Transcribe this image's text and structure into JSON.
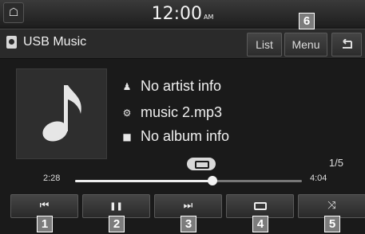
{
  "status_bar": {
    "home_icon": "home-icon",
    "time": "12:00",
    "ampm": "AM"
  },
  "header": {
    "source_icon": "usb-music-icon",
    "title": "USB Music",
    "list_label": "List",
    "menu_label": "Menu",
    "back_icon": "back-arrow-icon"
  },
  "album_art_icon": "music-note-icon",
  "track_info": {
    "artist": "No artist info",
    "file": "music 2.mp3",
    "album": "No album info"
  },
  "playback": {
    "repeat_icon": "repeat-indicator-icon",
    "track_count": "1/5",
    "elapsed": "2:28",
    "total": "4:04",
    "progress": 0.605
  },
  "controls": [
    {
      "icon": "previous-track-icon",
      "glyph": "⏮"
    },
    {
      "icon": "pause-icon",
      "glyph": "❚❚"
    },
    {
      "icon": "next-track-icon",
      "glyph": "⏭"
    },
    {
      "icon": "repeat-icon",
      "glyph": ""
    },
    {
      "icon": "shuffle-icon",
      "glyph": "⤨"
    }
  ],
  "callouts": [
    "1",
    "2",
    "3",
    "4",
    "5",
    "6"
  ]
}
